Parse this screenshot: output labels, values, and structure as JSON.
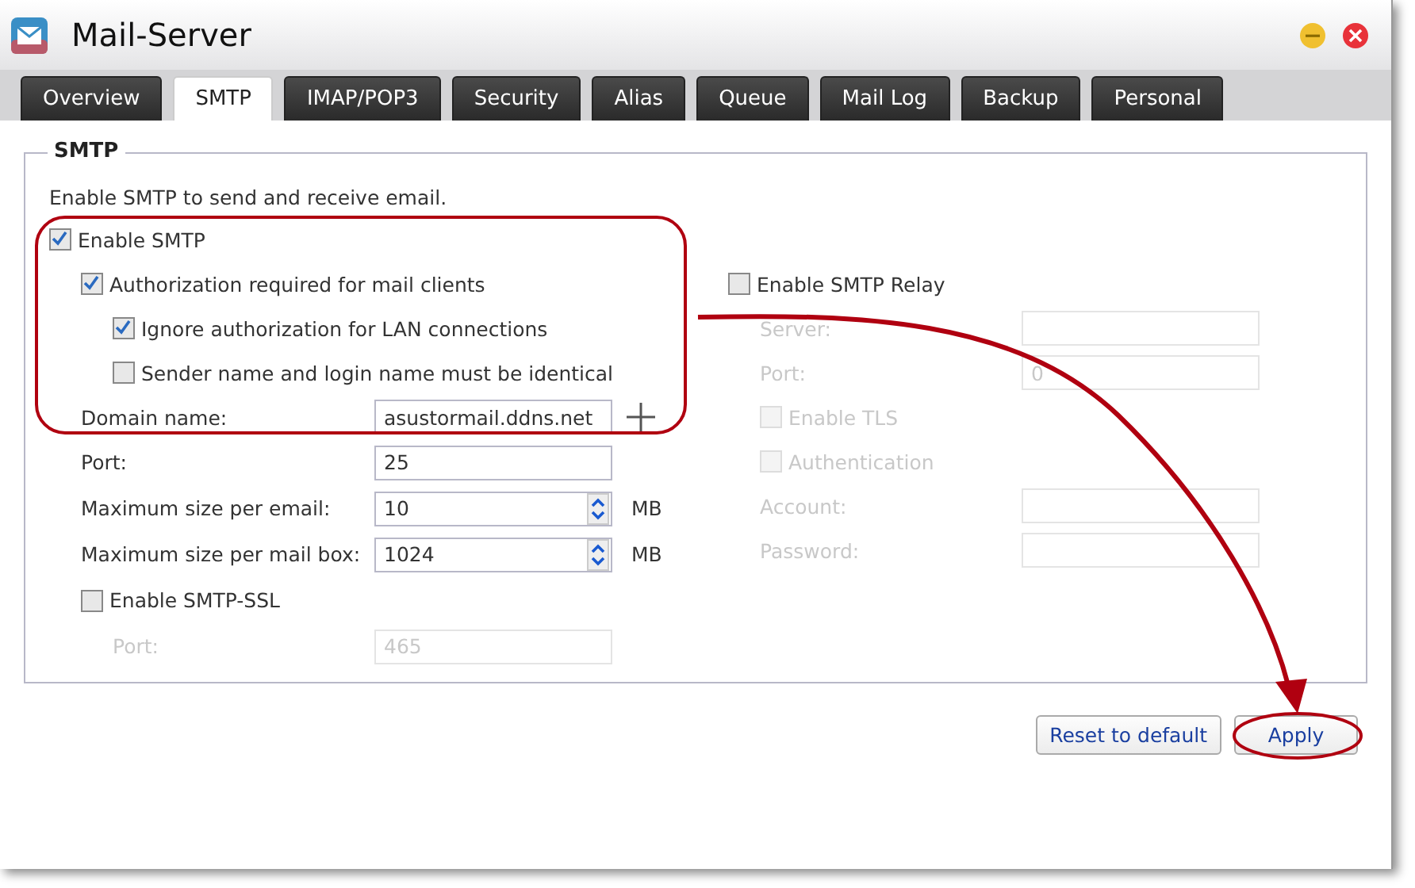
{
  "window": {
    "title": "Mail-Server"
  },
  "tabs": [
    {
      "label": "Overview",
      "selected": false
    },
    {
      "label": "SMTP",
      "selected": true
    },
    {
      "label": "IMAP/POP3",
      "selected": false
    },
    {
      "label": "Security",
      "selected": false
    },
    {
      "label": "Alias",
      "selected": false
    },
    {
      "label": "Queue",
      "selected": false
    },
    {
      "label": "Mail Log",
      "selected": false
    },
    {
      "label": "Backup",
      "selected": false
    },
    {
      "label": "Personal",
      "selected": false
    }
  ],
  "panel": {
    "legend": "SMTP",
    "description": "Enable SMTP to send and receive email.",
    "enable": {
      "kind": "check",
      "label": "Enable SMTP",
      "checked": true,
      "children": [
        {
          "kind": "check",
          "label": "Authorization required for mail clients",
          "checked": true,
          "disabled": false,
          "children": [
            {
              "kind": "check",
              "label": "Ignore authorization for LAN connections",
              "checked": true,
              "disabled": false
            },
            {
              "kind": "check",
              "label": "Sender name and login name must be identical",
              "checked": false,
              "disabled": false
            }
          ]
        },
        {
          "kind": "field",
          "label": "Domain name:",
          "value": "asustormail.ddns.net",
          "disabled": false,
          "add_button": true
        },
        {
          "kind": "field",
          "label": "Port:",
          "value": "25",
          "disabled": false
        },
        {
          "kind": "spin",
          "label": "Maximum size per email:",
          "value": "10",
          "unit": "MB",
          "disabled": false
        },
        {
          "kind": "spin",
          "label": "Maximum size per mail box:",
          "value": "1024",
          "unit": "MB",
          "disabled": false
        },
        {
          "kind": "check",
          "label": "Enable SMTP-SSL",
          "checked": false,
          "disabled": false,
          "children": [
            {
              "kind": "field",
              "label": "Port:",
              "value": "465",
              "disabled": true
            }
          ]
        }
      ]
    },
    "relay": {
      "kind": "check",
      "label": "Enable SMTP Relay",
      "checked": false,
      "children": [
        {
          "kind": "field",
          "label": "Server:",
          "disabled": true
        },
        {
          "kind": "field",
          "label": "Port:",
          "value": "0",
          "disabled": true
        },
        {
          "kind": "check",
          "label": "Enable TLS",
          "checked": false,
          "disabled": true
        },
        {
          "kind": "check",
          "label": "Authentication",
          "checked": false,
          "disabled": true
        },
        {
          "kind": "field",
          "label": "Account:",
          "disabled": true
        },
        {
          "kind": "field",
          "label": "Password:",
          "disabled": true
        }
      ]
    }
  },
  "buttons": [
    {
      "label": "Reset to default"
    },
    {
      "label": "Apply"
    }
  ]
}
